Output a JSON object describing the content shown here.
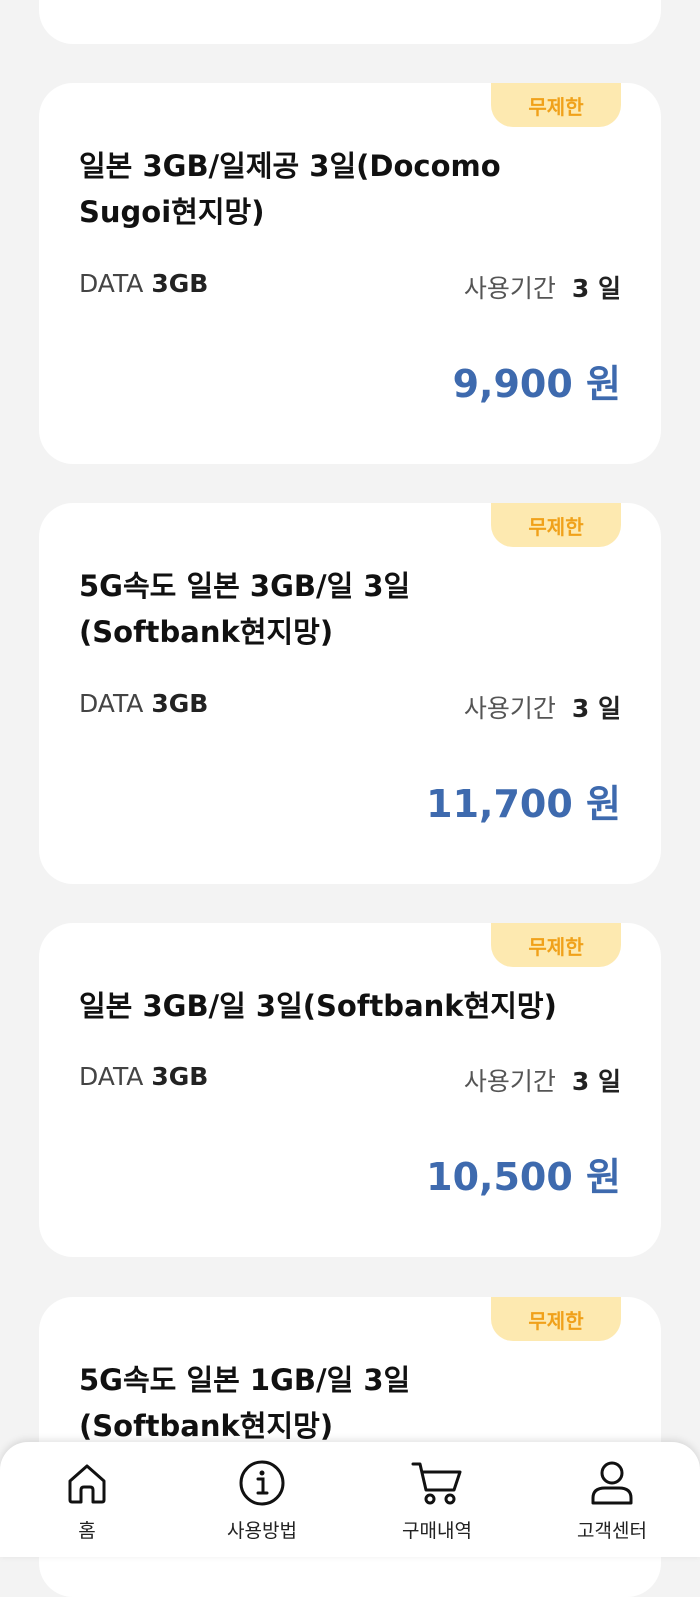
{
  "products": [
    {
      "badge": "무제한",
      "title": "일본 3GB/일제공 3일(Docomo Sugoi현지망)",
      "data_label": "DATA",
      "data_value": "3GB",
      "period_label": "사용기간",
      "period_value": "3 일",
      "price": "9,900 원"
    },
    {
      "badge": "무제한",
      "title": "5G속도 일본 3GB/일 3일 (Softbank현지망)",
      "data_label": "DATA",
      "data_value": "3GB",
      "period_label": "사용기간",
      "period_value": "3 일",
      "price": "11,700 원"
    },
    {
      "badge": "무제한",
      "title": "일본 3GB/일 3일(Softbank현지망)",
      "data_label": "DATA",
      "data_value": "3GB",
      "period_label": "사용기간",
      "period_value": "3 일",
      "price": "10,500 원"
    },
    {
      "badge": "무제한",
      "title": "5G속도 일본 1GB/일 3일 (Softbank현지망)"
    }
  ],
  "nav": [
    {
      "label": "홈",
      "icon": "home-icon"
    },
    {
      "label": "사용방법",
      "icon": "info-icon"
    },
    {
      "label": "구매내역",
      "icon": "cart-icon"
    },
    {
      "label": "고객센터",
      "icon": "user-icon"
    }
  ],
  "colors": {
    "background": "#f3f3f3",
    "badge_bg": "#fde9b0",
    "badge_text": "#f0a11a",
    "price": "#3e6aae"
  }
}
